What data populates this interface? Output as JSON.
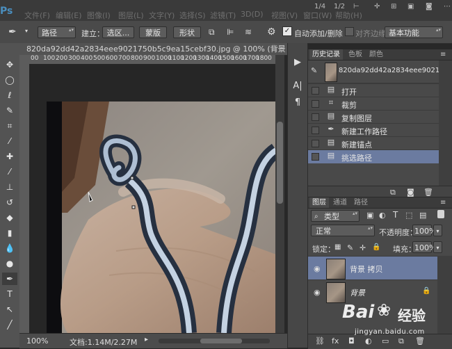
{
  "app": {
    "logo": "Ps"
  },
  "menu": [
    "文件(F)",
    "编辑(E)",
    "图像(I)",
    "图层(L)",
    "文字(Y)",
    "选择(S)",
    "滤镜(T)",
    "3D(D)",
    "视图(V)",
    "窗口(W)",
    "帮助(H)"
  ],
  "window_controls": {
    "zoom_a": "1/4",
    "zoom_b": "1/2"
  },
  "options_bar": {
    "mode": "路径",
    "make_label": "建立：",
    "selection": "选区...",
    "mask": "蒙版",
    "shape": "形状",
    "auto_add_delete": "自动添加/删除",
    "align_edges": "对齐边缘",
    "workspace": "基本功能"
  },
  "document": {
    "tab_title": "820da92dd42a2834eee9021750b5c9ea15cebf30.jpg @ 100% (背景 ...",
    "ruler_labels": [
      "00",
      "100",
      "200",
      "300",
      "400",
      "500",
      "600",
      "700",
      "800",
      "900",
      "1000",
      "1100",
      "1200",
      "1300",
      "1400",
      "1500",
      "1600",
      "1700",
      "1800"
    ],
    "zoom": "100%",
    "doc_size": "文档:1.14M/2.27M"
  },
  "history_panel": {
    "tabs": [
      "历史记录",
      "色板",
      "颜色"
    ],
    "snapshot_name": "820da92dd42a2834eee902175...",
    "items": [
      {
        "label": "打开"
      },
      {
        "label": "裁剪"
      },
      {
        "label": "复制图层"
      },
      {
        "label": "新建工作路径"
      },
      {
        "label": "新建锚点"
      },
      {
        "label": "挑选路径"
      }
    ]
  },
  "layers_panel": {
    "tabs": [
      "图层",
      "通道",
      "路径"
    ],
    "filter": "类型",
    "blend_mode": "正常",
    "opacity_label": "不透明度：",
    "opacity": "100%",
    "lock_label": "锁定：",
    "fill_label": "填充：",
    "fill": "100%",
    "layers": [
      {
        "name": "背景 拷贝"
      },
      {
        "name": "背景"
      }
    ]
  },
  "watermark": {
    "brand": "Bai",
    "brand_cn": "经验",
    "url": "jingyan.baidu.com"
  }
}
